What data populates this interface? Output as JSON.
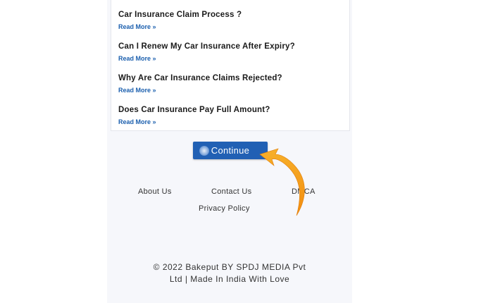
{
  "articles": [
    {
      "title": "Car Insurance Claim Process ?",
      "link": "Read More »"
    },
    {
      "title": "Can I Renew My Car Insurance After Expiry?",
      "link": "Read More »"
    },
    {
      "title": "Why Are Car Insurance Claims Rejected?",
      "link": "Read More »"
    },
    {
      "title": "Does Car Insurance Pay Full Amount?",
      "link": "Read More »"
    }
  ],
  "continue_button": {
    "label": "Continue"
  },
  "footer": {
    "links": [
      "About Us",
      "Contact Us",
      "DMCA",
      "Privacy Policy"
    ],
    "copyright_line1": "© 2022 Bakeput BY SPDJ MEDIA Pvt",
    "copyright_line2": "Ltd | Made In India With Love"
  },
  "colors": {
    "accent": "#2160b4",
    "link": "#1b5fae",
    "arrow": "#f5a623",
    "page_background": "#f6f7fb"
  },
  "icons": [
    "curved-arrow-icon"
  ]
}
